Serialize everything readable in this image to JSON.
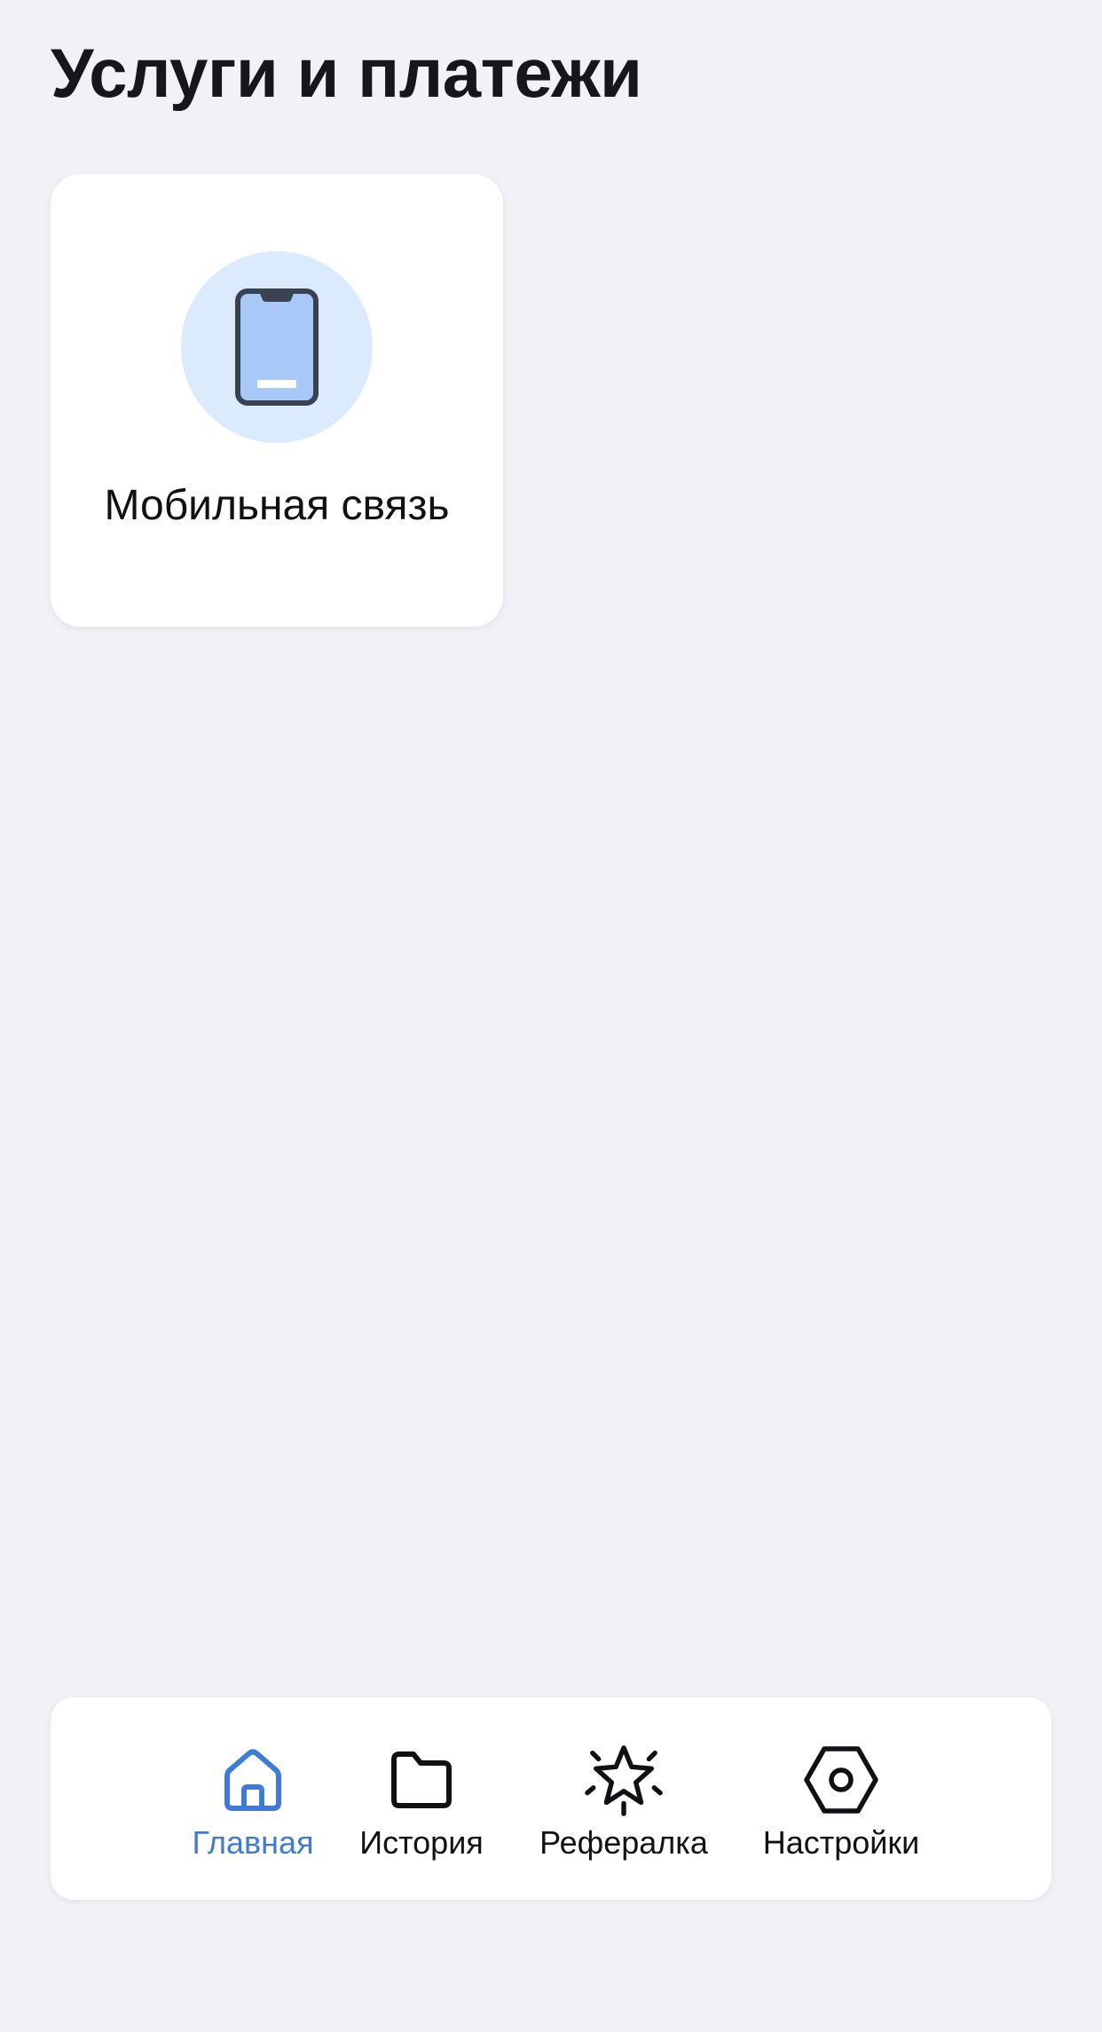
{
  "header": {
    "title": "Услуги и платежи"
  },
  "services": [
    {
      "label": "Мобильная связь",
      "icon": "smartphone-icon"
    }
  ],
  "tabbar": {
    "items": [
      {
        "label": "Главная",
        "icon": "home-icon",
        "active": true
      },
      {
        "label": "История",
        "icon": "folder-icon",
        "active": false
      },
      {
        "label": "Рефералка",
        "icon": "star-icon",
        "active": false
      },
      {
        "label": "Настройки",
        "icon": "settings-nut-icon",
        "active": false
      }
    ]
  },
  "colors": {
    "background": "#f1f1f7",
    "card": "#ffffff",
    "accent": "#3e7ad8",
    "icon_circle": "#dbeafc",
    "phone_screen": "#a8c8f8",
    "phone_body": "#3a4150"
  }
}
